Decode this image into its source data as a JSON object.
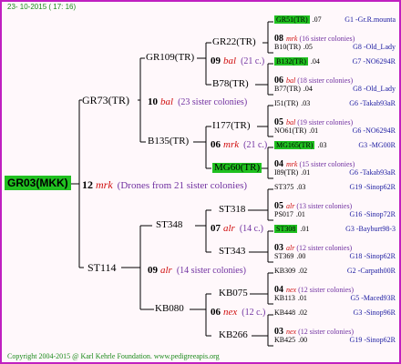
{
  "header": {
    "date": "23- 10-2015 ( 17: 16)"
  },
  "footer": {
    "text": "Copyright 2004-2015 @ Karl Kehrle Foundation.   www.pedigreeapis.org"
  },
  "colors": {
    "border": "#c020c0",
    "highlight": "#20c020",
    "blue": "#1a1aa0",
    "red": "#d01010",
    "green": "#1a8a1a"
  },
  "root": {
    "label": "GR03(MKK)"
  },
  "root_mid": {
    "num": "12",
    "mrk": "mrk",
    "note": "(Drones from 21 sister colonies)"
  },
  "g1": {
    "top": {
      "label": "GR73(TR)"
    },
    "bot": {
      "label": "ST114"
    }
  },
  "g1_mid": {
    "top": {
      "num": "10",
      "mrk": "bal",
      "note": "(23 sister colonies)"
    },
    "bot": {
      "num": "09",
      "mrk": "alr",
      "note": "(14 sister colonies)"
    }
  },
  "g2": [
    {
      "label": "GR109(TR)"
    },
    {
      "label": "B135(TR)"
    },
    {
      "label": "ST348"
    },
    {
      "label": "KB080"
    }
  ],
  "g2_mid": [
    {
      "num": "09",
      "mrk": "bal",
      "note": "(21 c.)"
    },
    {
      "num": "06",
      "mrk": "mrk",
      "note": "(21 c.)"
    },
    {
      "num": "07",
      "mrk": "alr",
      "note": "(14 c.)"
    },
    {
      "num": "06",
      "mrk": "nex",
      "note": "(12 c.)"
    }
  ],
  "g3": [
    {
      "label": "GR22(TR)",
      "hl": false
    },
    {
      "label": "B78(TR)",
      "hl": false
    },
    {
      "label": "I177(TR)",
      "hl": false
    },
    {
      "label": "MG60(TR)",
      "hl": true
    },
    {
      "label": "ST318",
      "hl": false
    },
    {
      "label": "ST343",
      "hl": false
    },
    {
      "label": "KB075",
      "hl": false
    },
    {
      "label": "KB266",
      "hl": false
    }
  ],
  "g4": [
    {
      "top": {
        "id": "GR51(TR)",
        "v": ".07",
        "r": "G1 -Gr.R.mounta",
        "hl": true
      },
      "num": "08",
      "mrk": "mrk",
      "note": "(16 sister colonies)",
      "bot": {
        "id": "B10(TR)",
        "v": ".05",
        "r": "G8 -Old_Lady",
        "hl": false
      }
    },
    {
      "top": {
        "id": "B132(TR)",
        "v": ".04",
        "r": "G7 -NO6294R",
        "hl": true
      },
      "num": "06",
      "mrk": "bal",
      "note": "(18 sister colonies)",
      "bot": {
        "id": "B77(TR)",
        "v": ".04",
        "r": "G8 -Old_Lady",
        "hl": false
      }
    },
    {
      "top": {
        "id": "I51(TR)",
        "v": ".03",
        "r": "G6 -Takab93aR",
        "hl": false
      },
      "num": "05",
      "mrk": "bal",
      "note": "(19 sister colonies)",
      "bot": {
        "id": "NO61(TR)",
        "v": ".01",
        "r": "G6 -NO6294R",
        "hl": false
      }
    },
    {
      "top": {
        "id": "MG165(TR)",
        "v": ".03",
        "r": "G3 -MG00R",
        "hl": true
      },
      "num": "04",
      "mrk": "mrk",
      "note": "(15 sister colonies)",
      "bot": {
        "id": "I89(TR)",
        "v": ".01",
        "r": "G6 -Takab93aR",
        "hl": false
      }
    },
    {
      "top": {
        "id": "ST375",
        "v": ".03",
        "r": "G19 -Sinop62R",
        "hl": false
      },
      "num": "05",
      "mrk": "alr",
      "note": "(13 sister colonies)",
      "bot": {
        "id": "PS017",
        "v": ".01",
        "r": "G16 -Sinop72R",
        "hl": false
      }
    },
    {
      "top": {
        "id": "ST308",
        "v": ".01",
        "r": "G3 -Bayburt98-3",
        "hl": true
      },
      "num": "03",
      "mrk": "alr",
      "note": "(12 sister colonies)",
      "bot": {
        "id": "ST369",
        "v": ".00",
        "r": "G18 -Sinop62R",
        "hl": false
      }
    },
    {
      "top": {
        "id": "KB309",
        "v": ".02",
        "r": "G2 -Carpath00R",
        "hl": false
      },
      "num": "04",
      "mrk": "nex",
      "note": "(12 sister colonies)",
      "bot": {
        "id": "KB113",
        "v": ".01",
        "r": "G5 -Maced93R",
        "hl": false
      }
    },
    {
      "top": {
        "id": "KB448",
        "v": ".02",
        "r": "G3 -Sinop96R",
        "hl": false
      },
      "num": "03",
      "mrk": "nex",
      "note": "(12 sister colonies)",
      "bot": {
        "id": "KB425",
        "v": ".00",
        "r": "G19 -Sinop62R",
        "hl": false
      }
    }
  ]
}
